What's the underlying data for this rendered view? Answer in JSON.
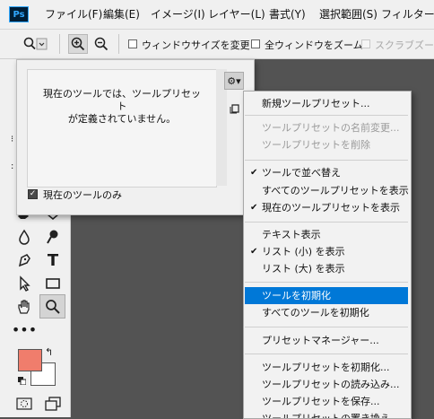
{
  "menubar": {
    "logo": "Ps",
    "items": [
      "ファイル(F)",
      "編集(E)",
      "イメージ(I)",
      "レイヤー(L)",
      "書式(Y)",
      "選択範囲(S)",
      "フィルター("
    ]
  },
  "options_bar": {
    "resize_windows_label": "ウィンドウサイズを変更",
    "zoom_all_label": "全ウィンドウをズーム",
    "scrubby_zoom_label": "スクラブズーム"
  },
  "preset_panel": {
    "empty_message_line1": "現在のツールでは、ツールプリセット",
    "empty_message_line2": "が定義されていません。",
    "current_tool_only_label": "現在のツールのみ",
    "current_tool_only_checked": true
  },
  "toolbar": {
    "foreground_color": "#f07d6c",
    "background_color": "#ffffff",
    "text_tool_glyph": "T"
  },
  "dropdown_menu": {
    "items": [
      {
        "label": "新規ツールプリセット...",
        "disabled": false,
        "checked": false,
        "highlight": false
      },
      {
        "label": "ツールプリセットの名前変更...",
        "disabled": true,
        "checked": false,
        "highlight": false
      },
      {
        "label": "ツールプリセットを削除",
        "disabled": true,
        "checked": false,
        "highlight": false
      },
      {
        "label": "ツールで並べ替え",
        "disabled": false,
        "checked": true,
        "highlight": false
      },
      {
        "label": "すべてのツールプリセットを表示",
        "disabled": false,
        "checked": false,
        "highlight": false
      },
      {
        "label": "現在のツールプリセットを表示",
        "disabled": false,
        "checked": true,
        "highlight": false
      },
      {
        "label": "テキスト表示",
        "disabled": false,
        "checked": false,
        "highlight": false
      },
      {
        "label": "リスト (小) を表示",
        "disabled": false,
        "checked": true,
        "highlight": false
      },
      {
        "label": "リスト (大) を表示",
        "disabled": false,
        "checked": false,
        "highlight": false
      },
      {
        "label": "ツールを初期化",
        "disabled": false,
        "checked": false,
        "highlight": true
      },
      {
        "label": "すべてのツールを初期化",
        "disabled": false,
        "checked": false,
        "highlight": false
      },
      {
        "label": "プリセットマネージャー...",
        "disabled": false,
        "checked": false,
        "highlight": false
      },
      {
        "label": "ツールプリセットを初期化...",
        "disabled": false,
        "checked": false,
        "highlight": false
      },
      {
        "label": "ツールプリセットの読み込み...",
        "disabled": false,
        "checked": false,
        "highlight": false
      },
      {
        "label": "ツールプリセットを保存...",
        "disabled": false,
        "checked": false,
        "highlight": false
      },
      {
        "label": "ツールプリセットの置き換え...",
        "disabled": false,
        "checked": false,
        "highlight": false
      }
    ],
    "check_glyph": "✔",
    "highlight_color": "#0078d7"
  }
}
